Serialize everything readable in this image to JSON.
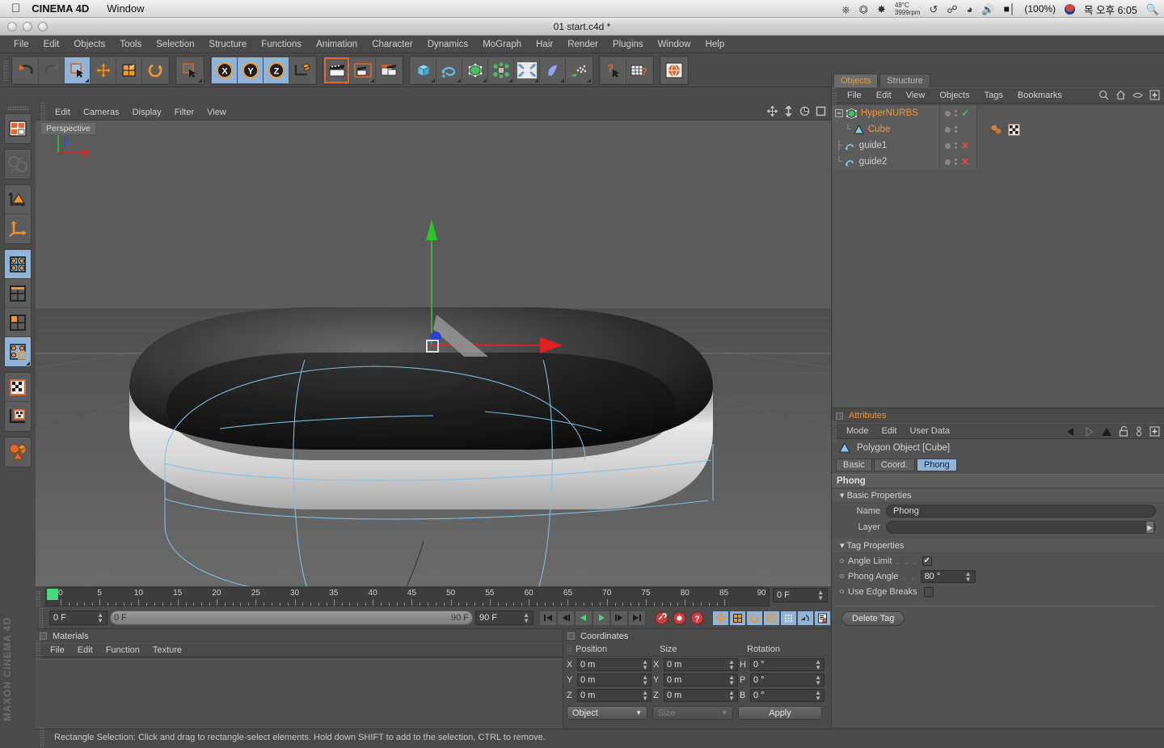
{
  "macos": {
    "app_name": "CINEMA 4D",
    "menus": [
      "Window"
    ],
    "status": {
      "temperature": "48°C",
      "fan_rpm": "3999rpm",
      "battery": "(100%)",
      "time": "목 오후 6:05",
      "icons": [
        "timemachine-icon",
        "eject-icon",
        "dropbox-icon",
        "bluetooth-icon",
        "wifi-icon",
        "volume-icon",
        "battery-icon",
        "korean-flag-icon",
        "spotlight-search-icon"
      ]
    }
  },
  "window": {
    "title": "01 start.c4d *",
    "menus": [
      "File",
      "Edit",
      "Objects",
      "Tools",
      "Selection",
      "Structure",
      "Functions",
      "Animation",
      "Character",
      "Dynamics",
      "MoGraph",
      "Hair",
      "Render",
      "Plugins",
      "Window",
      "Help"
    ]
  },
  "toolbar": {
    "groups": [
      {
        "buttons": [
          {
            "name": "undo-button",
            "icon": "undo-arrow-icon",
            "state": "normal"
          },
          {
            "name": "redo-button",
            "icon": "redo-arrow-icon",
            "state": "disabled"
          },
          {
            "name": "live-selection-button",
            "icon": "selection-cursor-icon",
            "state": "active"
          },
          {
            "name": "move-tool-button",
            "icon": "move-cross-icon",
            "state": "normal"
          },
          {
            "name": "scale-tool-button",
            "icon": "scale-box-icon",
            "state": "normal"
          },
          {
            "name": "rotate-tool-button",
            "icon": "rotate-circle-icon",
            "state": "normal"
          }
        ]
      },
      {
        "buttons": [
          {
            "name": "selection-mode-button",
            "icon": "selection-cursor-icon",
            "state": "normal"
          }
        ]
      },
      {
        "buttons": [
          {
            "name": "x-axis-lock-button",
            "icon": "axis-x-icon",
            "state": "active"
          },
          {
            "name": "y-axis-lock-button",
            "icon": "axis-y-icon",
            "state": "active"
          },
          {
            "name": "z-axis-lock-button",
            "icon": "axis-z-icon",
            "state": "active"
          },
          {
            "name": "world-object-coordinate-button",
            "icon": "world-axis-cube-icon",
            "state": "normal"
          }
        ]
      },
      {
        "buttons": [
          {
            "name": "render-view-button",
            "icon": "clapper-render-icon",
            "state": "selected"
          },
          {
            "name": "render-region-button",
            "icon": "clapper-region-icon",
            "state": "normal"
          },
          {
            "name": "render-settings-button",
            "icon": "render-settings-icon",
            "state": "normal"
          }
        ]
      },
      {
        "buttons": [
          {
            "name": "add-cube-button",
            "icon": "cube-primitive-icon",
            "state": "normal"
          },
          {
            "name": "add-spline-button",
            "icon": "spline-curve-icon",
            "state": "normal"
          },
          {
            "name": "add-hypernurbs-button",
            "icon": "hypernurbs-cage-icon",
            "state": "normal"
          },
          {
            "name": "add-array-button",
            "icon": "array-modeling-icon",
            "state": "normal"
          },
          {
            "name": "add-explosion-deformer-button",
            "icon": "deformer-burst-icon",
            "state": "normal"
          },
          {
            "name": "add-bend-deformer-button",
            "icon": "bend-deformer-icon",
            "state": "normal"
          },
          {
            "name": "add-emitter-button",
            "icon": "particle-emitter-icon",
            "state": "normal"
          }
        ]
      },
      {
        "buttons": [
          {
            "name": "help-cursor-button",
            "icon": "question-cursor-icon",
            "state": "normal"
          },
          {
            "name": "content-browser-button",
            "icon": "content-browser-icon",
            "state": "normal"
          }
        ]
      },
      {
        "buttons": [
          {
            "name": "web-button",
            "icon": "globe-icon",
            "state": "normal"
          }
        ]
      }
    ]
  },
  "left_toolbar": {
    "groups": [
      {
        "buttons": [
          {
            "name": "layout-switch-button",
            "icon": "layout-grid-icon",
            "state": "normal"
          }
        ]
      },
      {
        "buttons": [
          {
            "name": "world-axis-button",
            "icon": "world-globe-axis-icon",
            "state": "disabled"
          }
        ]
      },
      {
        "buttons": [
          {
            "name": "model-mode-button",
            "icon": "model-triangle-axis-icon",
            "state": "normal"
          },
          {
            "name": "object-axis-mode-button",
            "icon": "object-axis-icon",
            "state": "normal"
          }
        ]
      },
      {
        "buttons": [
          {
            "name": "point-mode-button",
            "icon": "points-grid-icon",
            "state": "active"
          },
          {
            "name": "edge-mode-button",
            "icon": "edge-grid-icon",
            "state": "normal"
          },
          {
            "name": "polygon-mode-button",
            "icon": "polygon-grid-icon",
            "state": "normal"
          },
          {
            "name": "uv-point-mode-button",
            "icon": "uv-points-icon",
            "state": "active"
          }
        ]
      },
      {
        "buttons": [
          {
            "name": "texture-mode-button",
            "icon": "texture-checker-icon",
            "state": "normal"
          },
          {
            "name": "texture-axis-mode-button",
            "icon": "texture-axis-icon",
            "state": "normal"
          }
        ]
      },
      {
        "buttons": [
          {
            "name": "viewport-solo-button",
            "icon": "solo-objects-icon",
            "state": "normal"
          }
        ]
      }
    ],
    "branding_top": "MAXON",
    "branding_bottom": "CINEMA 4D"
  },
  "viewport": {
    "menus": [
      "Edit",
      "Cameras",
      "Display",
      "Filter",
      "View"
    ],
    "label": "Perspective",
    "nav_icons": [
      "pan-view-icon",
      "dolly-view-icon",
      "orbit-view-icon",
      "maximize-view-icon"
    ],
    "axis_gizmo": {
      "x": "X",
      "y": "Y",
      "z": "Z"
    }
  },
  "object_manager": {
    "tabs": [
      {
        "label": "Objects",
        "active": true
      },
      {
        "label": "Structure",
        "active": false
      }
    ],
    "menus": [
      "File",
      "Edit",
      "View",
      "Objects",
      "Tags",
      "Bookmarks"
    ],
    "header_icons": [
      "search-icon",
      "home-icon",
      "eye-icon",
      "add-icon"
    ],
    "objects": [
      {
        "name": "HyperNURBS",
        "icon": "hypernurbs-icon",
        "indent": 0,
        "highlight": true,
        "enabled": "check",
        "expander": "minus"
      },
      {
        "name": "Cube",
        "icon": "polygon-object-icon",
        "indent": 1,
        "highlight": true,
        "enabled": "none",
        "expander": "none",
        "tags": [
          "material-tag",
          "phong-tag"
        ]
      },
      {
        "name": "guide1",
        "icon": "spline-object-icon",
        "indent": 0,
        "highlight": false,
        "enabled": "cross",
        "expander": "none"
      },
      {
        "name": "guide2",
        "icon": "spline-object-icon",
        "indent": 0,
        "highlight": false,
        "enabled": "cross",
        "expander": "none"
      }
    ]
  },
  "attributes": {
    "title": "Attributes",
    "menus": [
      "Mode",
      "Edit",
      "User Data"
    ],
    "header_icons": [
      "back-arrow-icon",
      "forward-arrow-icon",
      "up-arrow-icon",
      "lock-icon",
      "pin-icon",
      "add-icon"
    ],
    "object_label": "Polygon Object [Cube]",
    "object_icon": "polygon-object-icon",
    "tabs": [
      {
        "label": "Basic",
        "active": false
      },
      {
        "label": "Coord.",
        "active": false
      },
      {
        "label": "Phong",
        "active": true
      }
    ],
    "section_title": "Phong",
    "basic_properties": {
      "group_label": "Basic Properties",
      "name_label": "Name",
      "name_value": "Phong",
      "layer_label": "Layer",
      "layer_value": ""
    },
    "tag_properties": {
      "group_label": "Tag Properties",
      "angle_limit_label": "Angle Limit",
      "angle_limit_checked": true,
      "phong_angle_label": "Phong Angle",
      "phong_angle_value": "80 °",
      "use_edge_breaks_label": "Use Edge Breaks",
      "use_edge_breaks_checked": false
    },
    "delete_tag_label": "Delete Tag"
  },
  "timeline": {
    "ticks": [
      0,
      5,
      10,
      15,
      20,
      25,
      30,
      35,
      40,
      45,
      50,
      55,
      60,
      65,
      70,
      75,
      80,
      85,
      90
    ],
    "range_start": 0,
    "range_end": 90,
    "current_frame_label": "0 F",
    "end_frame_box": "0 F",
    "start_field": "0 F",
    "preview_start": "0 F",
    "preview_end": "90 F",
    "preview_end_field": "90 F",
    "playback_icons": [
      "go-to-start-icon",
      "step-back-icon",
      "play-back-icon",
      "play-forward-icon",
      "step-forward-icon",
      "go-to-end-icon"
    ],
    "record_icons": [
      "record-key-icon",
      "autokey-icon",
      "keyframe-selection-icon"
    ],
    "key_icons": [
      "key-position-icon",
      "key-scale-icon",
      "key-rotation-icon",
      "key-param-icon",
      "key-points-icon",
      "key-animate-icon",
      "key-layer-icon"
    ]
  },
  "materials": {
    "title": "Materials",
    "menus": [
      "File",
      "Edit",
      "Function",
      "Texture"
    ]
  },
  "coordinates": {
    "title": "Coordinates",
    "columns": [
      "Position",
      "Size",
      "Rotation"
    ],
    "rows": [
      {
        "pos_axis": "X",
        "pos_value": "0 m",
        "size_axis": "X",
        "size_value": "0 m",
        "rot_axis": "H",
        "rot_value": "0 °"
      },
      {
        "pos_axis": "Y",
        "pos_value": "0 m",
        "size_axis": "Y",
        "size_value": "0 m",
        "rot_axis": "P",
        "rot_value": "0 °"
      },
      {
        "pos_axis": "Z",
        "pos_value": "0 m",
        "size_axis": "Z",
        "size_value": "0 m",
        "rot_axis": "B",
        "rot_value": "0 °"
      }
    ],
    "object_dropdown": "Object",
    "size_dropdown": "Size",
    "apply_button": "Apply"
  },
  "status_bar": {
    "message": "Rectangle Selection: Click and drag to rectangle-select elements. Hold down SHIFT to add to the selection, CTRL to remove."
  },
  "colors": {
    "accent_orange": "#f0952f",
    "highlight_blue": "#8fb4d8",
    "panel_bg": "#4a4a4a",
    "axis_x": "#e03030",
    "axis_y": "#30c030",
    "axis_z": "#3050e0"
  }
}
